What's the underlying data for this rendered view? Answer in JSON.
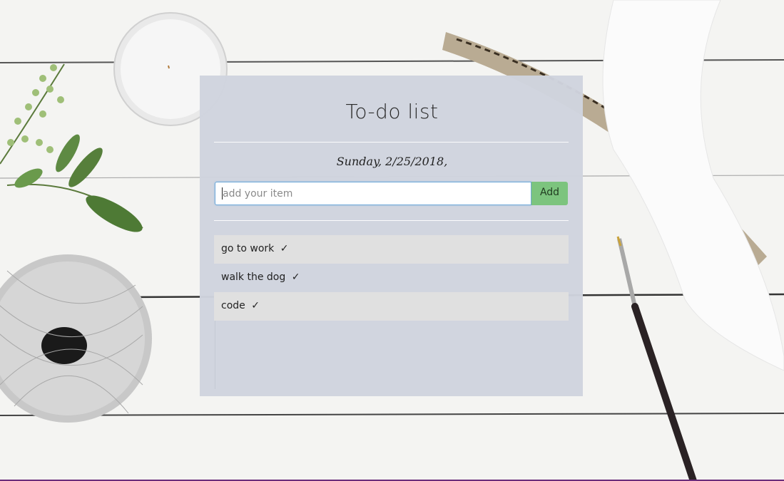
{
  "app": {
    "title": "To-do list",
    "date": "Sunday, 2/25/2018,"
  },
  "form": {
    "input_value": "",
    "placeholder": "add your item",
    "add_label": "Add"
  },
  "todos": [
    {
      "text": "go to work",
      "check": "✓",
      "shaded": true
    },
    {
      "text": "walk the dog",
      "check": "✓",
      "shaded": false
    },
    {
      "text": "code",
      "check": "✓",
      "shaded": true
    }
  ],
  "colors": {
    "card_bg": "#cfd4de",
    "add_button": "#7cc47e",
    "item_shaded": "#e0e0e0",
    "input_focus_border": "#6fa8d8"
  }
}
